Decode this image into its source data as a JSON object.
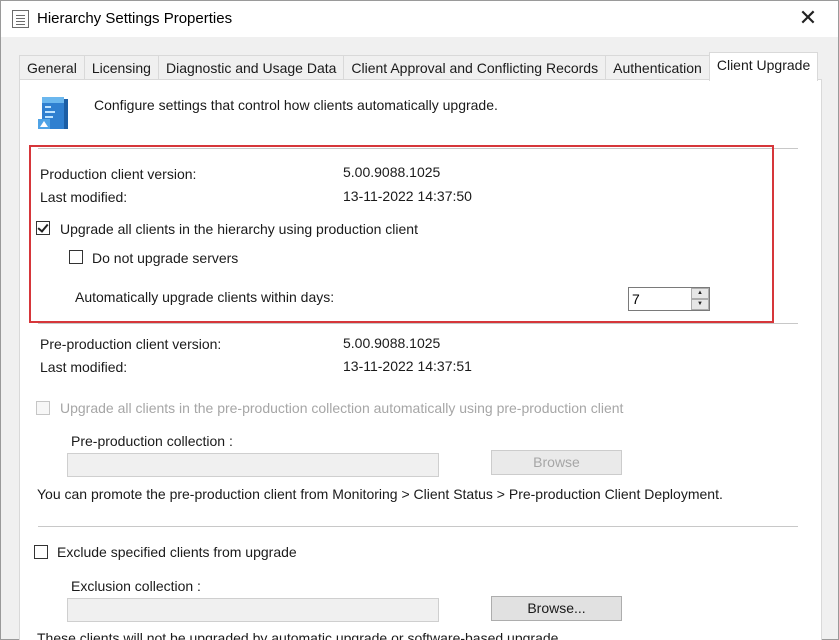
{
  "window": {
    "title": "Hierarchy Settings Properties",
    "close_glyph": "✕"
  },
  "tabs": [
    {
      "label": "General"
    },
    {
      "label": "Licensing"
    },
    {
      "label": "Diagnostic and Usage Data"
    },
    {
      "label": "Client Approval and Conflicting Records"
    },
    {
      "label": "Authentication"
    },
    {
      "label": "Client Upgrade",
      "active": true
    }
  ],
  "header": {
    "icon": "client-upgrade-icon",
    "description": "Configure settings that control how clients automatically upgrade."
  },
  "production": {
    "version_label": "Production client version:",
    "version_value": "5.00.9088.1025",
    "modified_label": "Last modified:",
    "modified_value": "13-11-2022 14:37:50",
    "upgrade_all_label": "Upgrade all clients in the hierarchy using production client",
    "upgrade_all_checked": true,
    "no_servers_label": "Do not upgrade servers",
    "no_servers_checked": false,
    "within_days_label": "Automatically upgrade clients within days:",
    "within_days_value": "7"
  },
  "preproduction": {
    "version_label": "Pre-production client version:",
    "version_value": "5.00.9088.1025",
    "modified_label": "Last modified:",
    "modified_value": "13-11-2022 14:37:51",
    "upgrade_label": "Upgrade all clients in the pre-production collection automatically using pre-production client",
    "collection_label": "Pre-production collection :",
    "collection_value": "",
    "browse_label": "Browse",
    "promote_note": "You can promote the pre-production client from Monitoring > Client Status > Pre-production Client Deployment."
  },
  "exclusion": {
    "exclude_label": "Exclude specified clients from upgrade",
    "exclude_checked": false,
    "collection_label": "Exclusion collection :",
    "collection_value": "",
    "browse_label": "Browse...",
    "note": "These clients will not be upgraded by automatic upgrade or software-based upgrade."
  },
  "colors": {
    "highlight": "#d6363a",
    "panel": "#ffffff",
    "chrome": "#f0f0f0"
  }
}
